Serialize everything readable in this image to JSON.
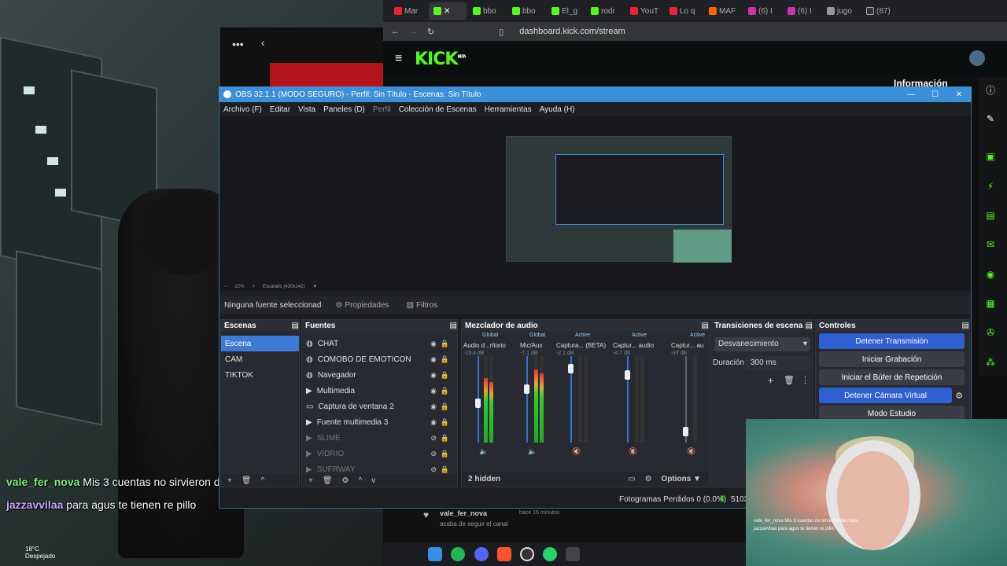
{
  "game": {
    "chat": [
      {
        "user": "vale_fer_nova",
        "text": "Mis 3 cuentas no sirvieron de nada",
        "color": "#7df57a"
      },
      {
        "user": "jazzavvilaa",
        "text": "para agus te tienen re pillo",
        "color": "#c9a7ff"
      }
    ],
    "weather": {
      "temp": "18°C",
      "desc": "Despejado"
    }
  },
  "browser": {
    "tabs": [
      "Mar",
      "bbo",
      "bbo",
      "El_g",
      "rodr",
      "YouT",
      "Lo q",
      "MAF",
      "(6) I",
      "(6) I",
      "jugo",
      "(87)"
    ],
    "url": "dashboard.kick.com/stream",
    "kick_logo": "KICK",
    "kick_beta": "BETA",
    "info_label": "Información",
    "follower": {
      "user": "vale_fer_nova",
      "time": "hace 16 minutos",
      "action": "acaba de seguir el canal"
    }
  },
  "obs": {
    "title": "OBS 32.1.1 (MODO SEGURO) - Perfil: Sin Título - Escenas: Sin Título",
    "menu": [
      "Archivo (F)",
      "Editar",
      "Vista",
      "Paneles (D)",
      "Perfil",
      "Colección de Escenas",
      "Herramientas",
      "Ayuda (H)"
    ],
    "zoom": "22%",
    "scale": "Escalado (430x242)",
    "no_source": "Ninguna fuente seleccionad",
    "properties": "Propiedades",
    "filters": "Filtros",
    "scenes_title": "Escenas",
    "scenes": [
      "Escena",
      "CAM",
      "TIKTOK"
    ],
    "sources_title": "Fuentes",
    "sources": [
      {
        "name": "CHAT",
        "icon": "globe-icon",
        "dim": false
      },
      {
        "name": "COMOBO DE EMOTICON",
        "icon": "globe-icon",
        "dim": false
      },
      {
        "name": "Navegador",
        "icon": "globe-icon",
        "dim": false
      },
      {
        "name": "Multimedia",
        "icon": "play-icon",
        "dim": false
      },
      {
        "name": "Captura de ventana 2",
        "icon": "window-icon",
        "dim": false
      },
      {
        "name": "Fuente multimedia 3",
        "icon": "play-icon",
        "dim": false
      },
      {
        "name": "SLIME",
        "icon": "play-icon",
        "dim": true
      },
      {
        "name": "VIDRIO",
        "icon": "play-icon",
        "dim": true
      },
      {
        "name": "SUFRWAY",
        "icon": "play-icon",
        "dim": true
      }
    ],
    "mixer_title": "Mezclador de audio",
    "mixer": [
      {
        "tag": "Global",
        "name": "Audio d...ritorio",
        "db": "-15.4 dB",
        "level": 0.45
      },
      {
        "tag": "Global",
        "name": "Mic/Aux",
        "db": "-7.1 dB",
        "level": 0.7
      },
      {
        "tag": "Active",
        "name": "Captura... (BETA)",
        "db": "-2.1 dB",
        "level": 0.0
      },
      {
        "tag": "Active",
        "name": "Captur... audio",
        "db": "-4.7 dB",
        "level": 0.0
      },
      {
        "tag": "Active",
        "name": "Captur... au",
        "db": "-inf dB",
        "level": 0.0
      }
    ],
    "meter_ticks": [
      "0",
      "-6",
      "-12",
      "-18",
      "-24",
      "-30",
      "-36",
      "-42",
      "-48",
      "-54",
      "-60"
    ],
    "hidden": "2 hidden",
    "options": "Options",
    "transitions_title": "Transiciones de escena",
    "transition": "Desvanecimiento",
    "duration_label": "Duración",
    "duration": "300 ms",
    "controls_title": "Controles",
    "controls": [
      {
        "label": "Detener Transmisión",
        "primary": true
      },
      {
        "label": "Iniciar Grabación",
        "primary": false
      },
      {
        "label": "Iniciar el Búfer de Repetición",
        "primary": false
      },
      {
        "label": "Detener Cámara Virtual",
        "primary": true
      },
      {
        "label": "Modo Estudio",
        "primary": false
      }
    ],
    "status": {
      "frames": "Fotogramas Perdidos 0 (0.0%)",
      "bitrate": "5103"
    }
  },
  "webcam": {
    "chat": [
      "vale_fer_nova Mis 3 cuentas no sirvieron de nada",
      "jazzavvilaa para agus te tienen re pillo"
    ]
  }
}
